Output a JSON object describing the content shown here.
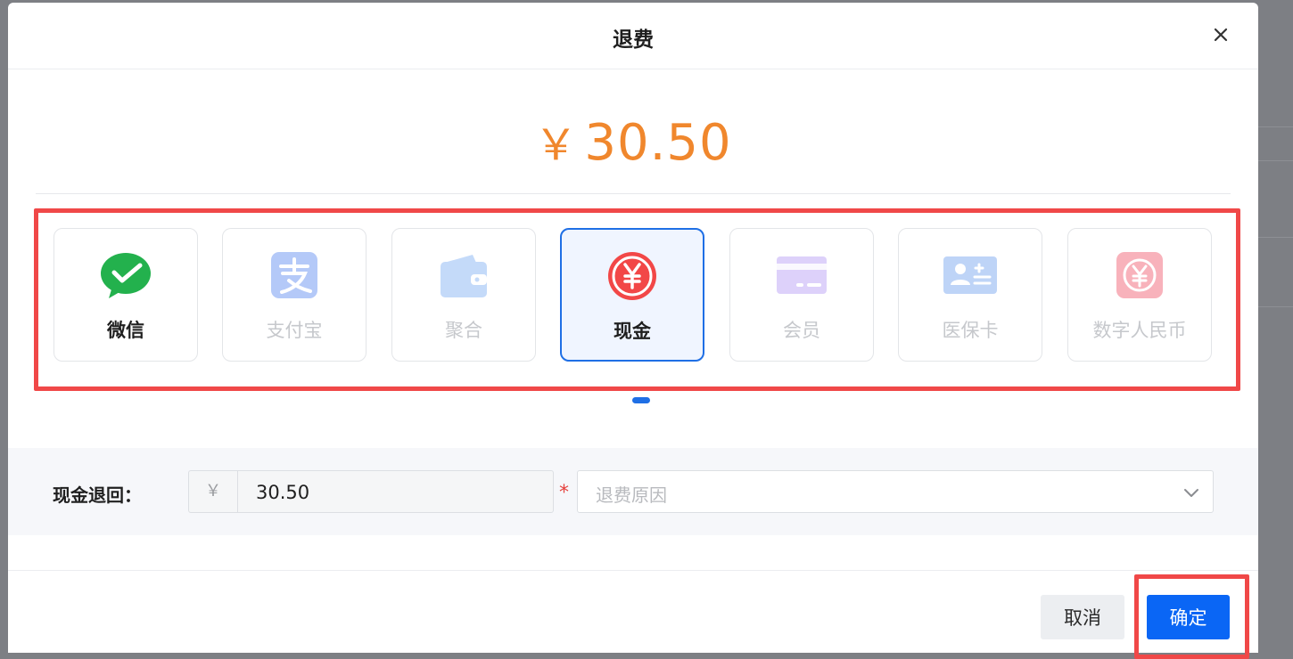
{
  "modal": {
    "title": "退费",
    "close_icon": "close-icon"
  },
  "amount": {
    "symbol": "￥",
    "value": "30.50",
    "color": "#f0872d"
  },
  "payment_methods": [
    {
      "label": "微信",
      "icon": "wechat-icon",
      "state": "available",
      "color": "#23b14d"
    },
    {
      "label": "支付宝",
      "icon": "alipay-icon",
      "state": "disabled",
      "color": "#6f98f2"
    },
    {
      "label": "聚合",
      "icon": "wallet-icon",
      "state": "disabled",
      "color": "#8ab6f5"
    },
    {
      "label": "现金",
      "icon": "cash-yuan-icon",
      "state": "selected",
      "color": "#f24747"
    },
    {
      "label": "会员",
      "icon": "member-card-icon",
      "state": "disabled",
      "color": "#c8b3f7"
    },
    {
      "label": "医保卡",
      "icon": "medical-insurance-card-icon",
      "state": "disabled",
      "color": "#8ab2f2"
    },
    {
      "label": "数字人民币",
      "icon": "digital-rmb-icon",
      "state": "disabled",
      "color": "#f47f8f"
    }
  ],
  "pager": {
    "active_index": 0,
    "total_pages": 1
  },
  "refund_form": {
    "label": "现金退回：",
    "currency_prefix": "￥",
    "amount_value": "30.50",
    "required_mark": "*",
    "reason_placeholder": "退费原因"
  },
  "footer": {
    "cancel_label": "取消",
    "confirm_label": "确定",
    "primary_color": "#0a66f5"
  }
}
